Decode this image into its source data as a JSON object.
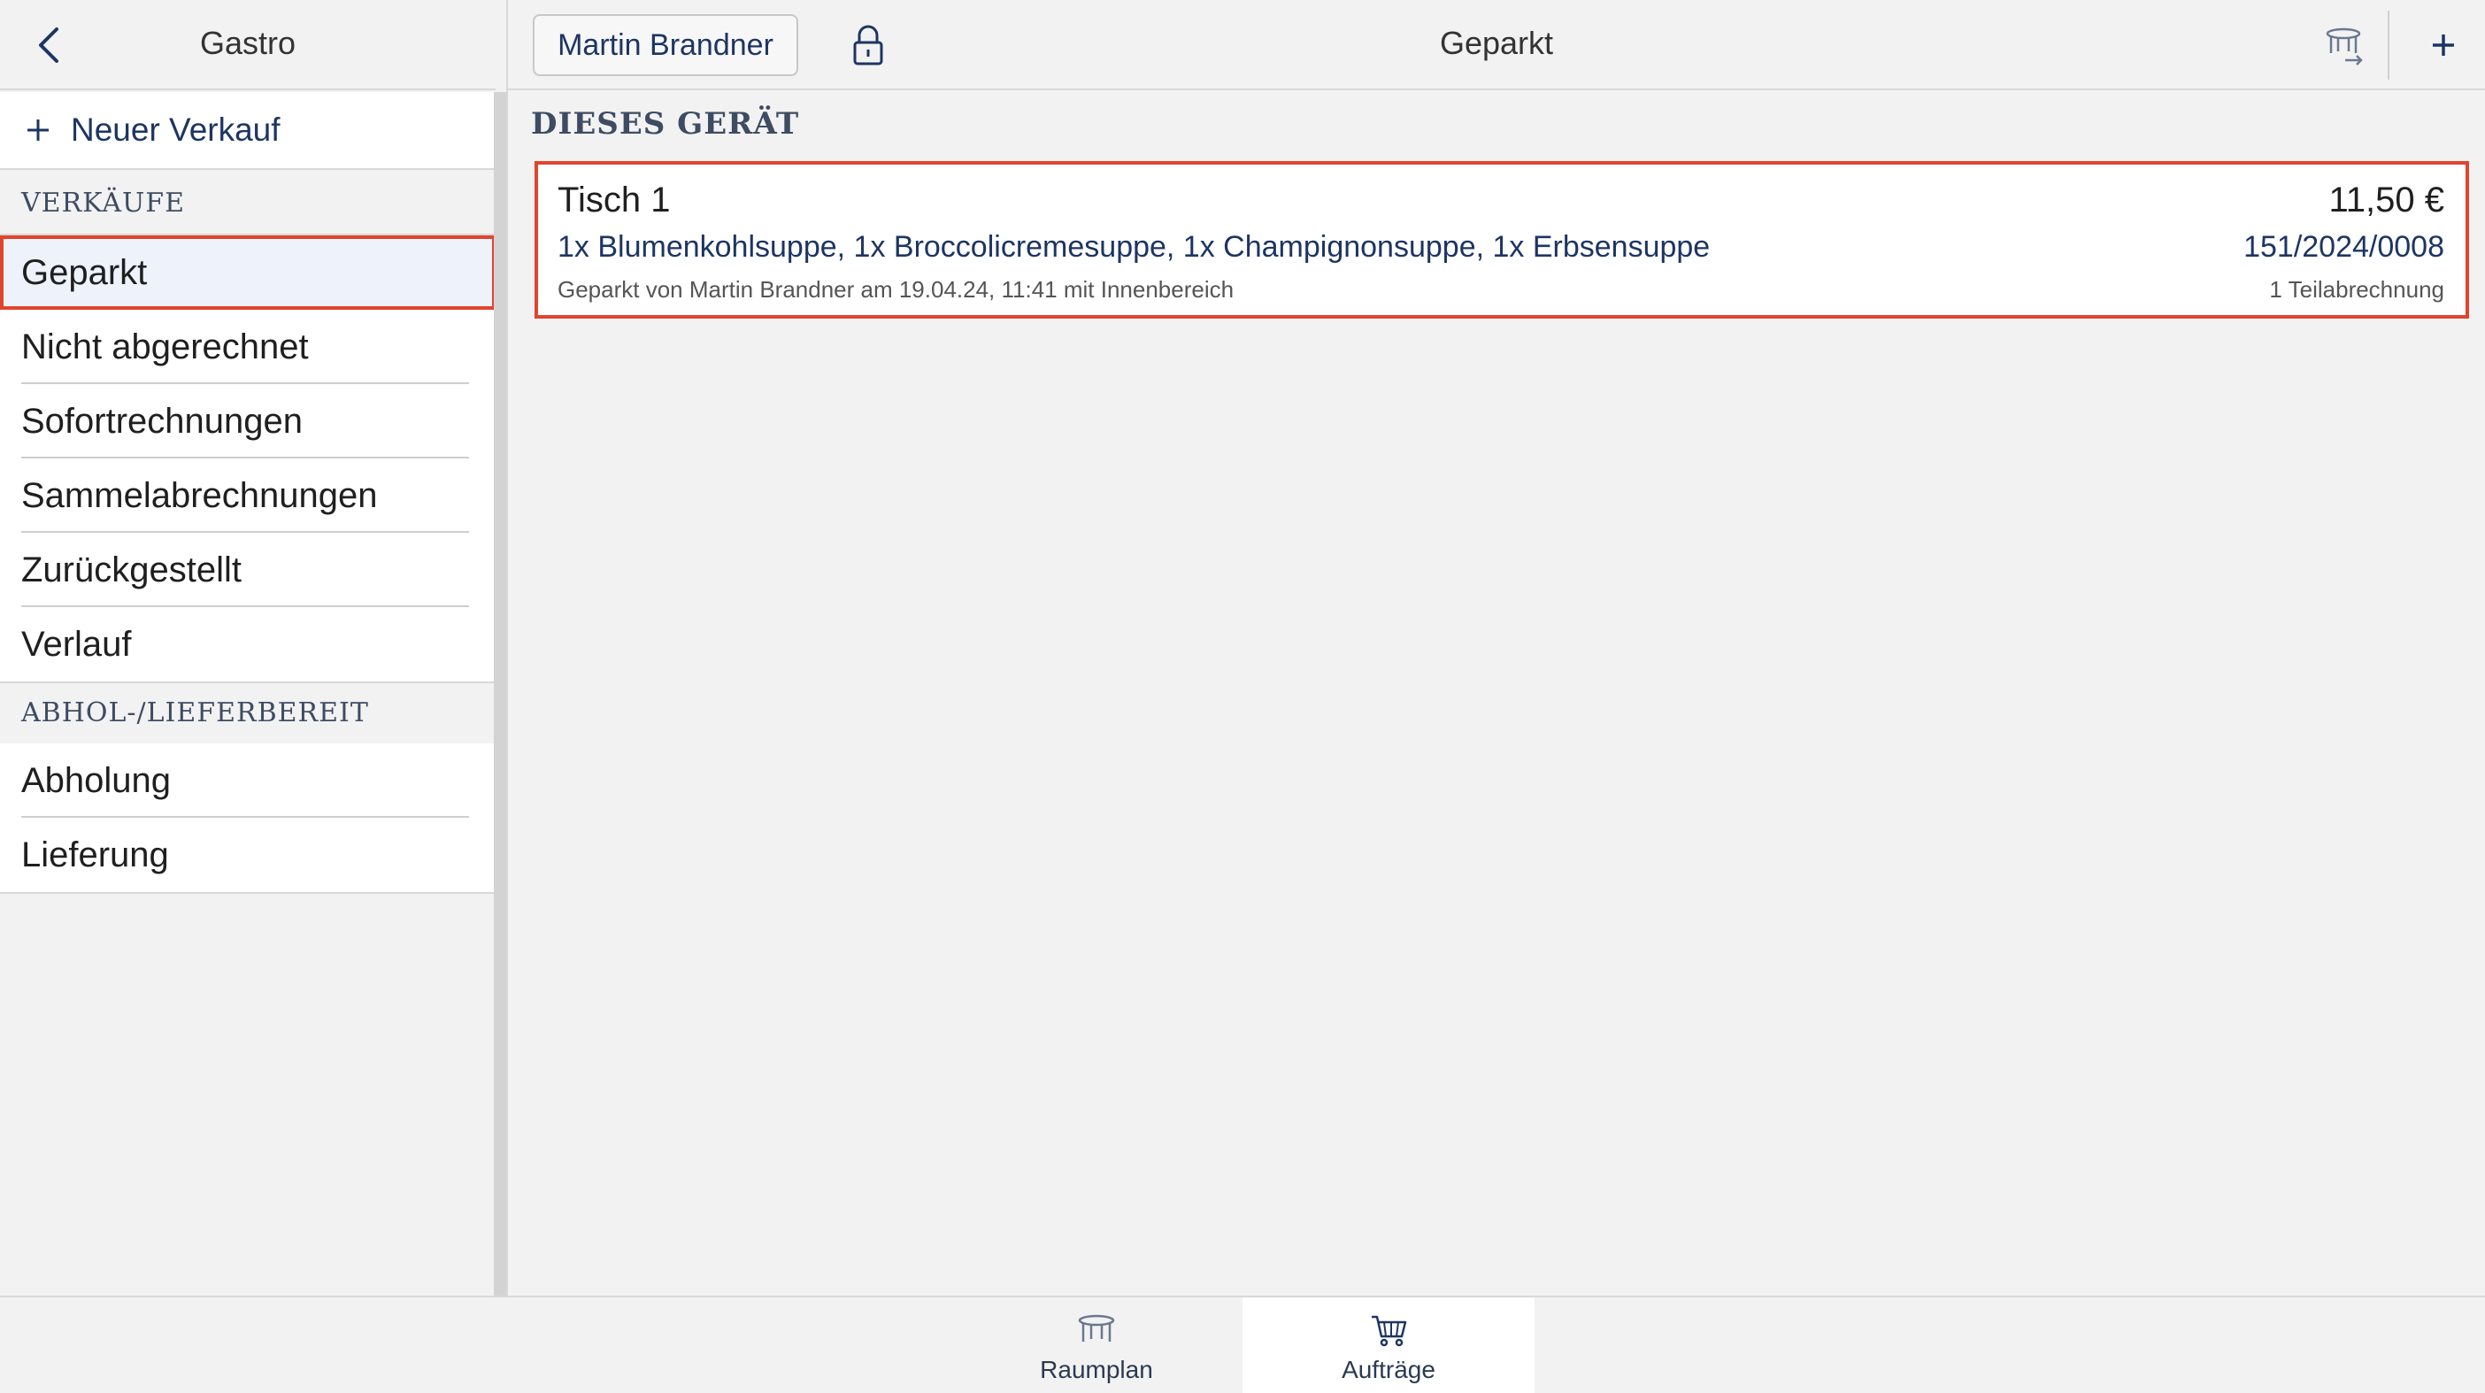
{
  "sidebar": {
    "title": "Gastro",
    "new_sale_label": "Neuer Verkauf",
    "sections": [
      {
        "header": "VERKÄUFE",
        "items": [
          {
            "label": "Geparkt",
            "selected": true
          },
          {
            "label": "Nicht abgerechnet"
          },
          {
            "label": "Sofortrechnungen"
          },
          {
            "label": "Sammelabrechnungen"
          },
          {
            "label": "Zurückgestellt"
          },
          {
            "label": "Verlauf"
          }
        ]
      },
      {
        "header": "ABHOL-/LIEFERBEREIT",
        "items": [
          {
            "label": "Abholung"
          },
          {
            "label": "Lieferung"
          }
        ]
      }
    ]
  },
  "header": {
    "user_button": "Martin Brandner",
    "title": "Geparkt"
  },
  "main": {
    "group_label": "DIESES GERÄT",
    "order": {
      "title": "Tisch 1",
      "amount": "11,50 €",
      "items": "1x Blumenkohlsuppe, 1x Broccolicremesuppe, 1x Champignonsuppe, 1x Erbsensuppe",
      "number": "151/2024/0008",
      "meta": "Geparkt von Martin Brandner am 19.04.24, 11:41 mit Innenbereich",
      "partial": "1 Teilabrechnung"
    }
  },
  "tabbar": {
    "tabs": [
      {
        "label": "Raumplan",
        "icon": "table-icon"
      },
      {
        "label": "Aufträge",
        "icon": "cart-icon",
        "active": true
      }
    ]
  },
  "colors": {
    "accent": "#1d3563",
    "highlight": "#e0452d",
    "selected_bg": "#eef3fb"
  }
}
